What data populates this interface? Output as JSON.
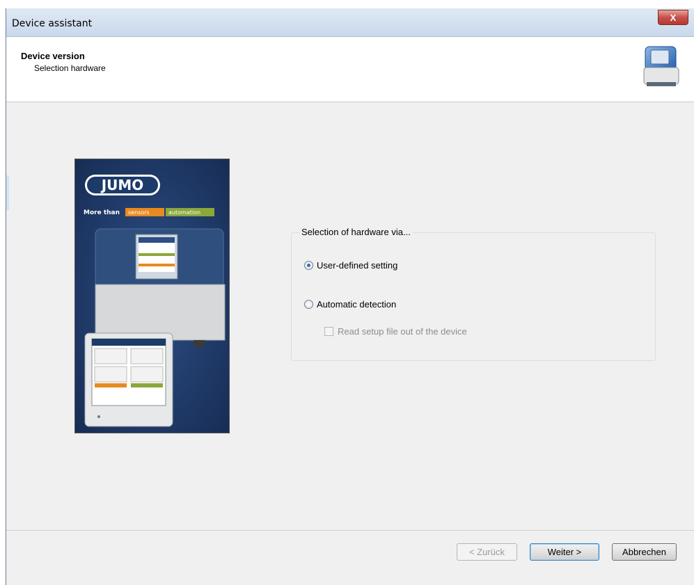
{
  "window": {
    "title": "Device assistant",
    "close_label": "X"
  },
  "header": {
    "title": "Device version",
    "subtitle": "Selection hardware",
    "icon": "device-controller-icon"
  },
  "product_image": {
    "brand": "JUMO",
    "tagline": "More than",
    "tag_sensors": "sensors",
    "tag_automation": "automation"
  },
  "group": {
    "legend": "Selection of hardware via...",
    "options": [
      {
        "label": "User-defined setting",
        "checked": true
      },
      {
        "label": "Automatic detection",
        "checked": false
      }
    ],
    "checkbox": {
      "label": "Read setup file out of the device",
      "checked": false,
      "enabled": false
    }
  },
  "buttons": {
    "back": "< Zurück",
    "next": "Weiter >",
    "cancel": "Abbrechen"
  },
  "colors": {
    "title_bar": "#c9d9ec",
    "close": "#c75050",
    "image_bg": "#1c3a6a"
  }
}
